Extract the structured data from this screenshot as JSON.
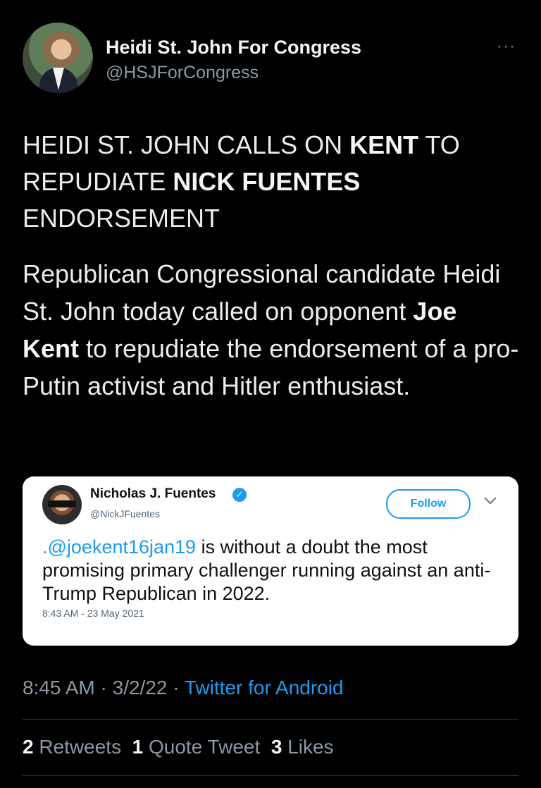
{
  "author": {
    "display_name": "Heidi St. John For Congress",
    "handle": "@HSJForCongress",
    "avatar_icon": "profile-photo",
    "more_icon": "···"
  },
  "tweet": {
    "headline": {
      "part1": "HEIDI ST. JOHN CALLS ON ",
      "bold1": "KENT",
      "part2": " TO REPUDIATE ",
      "bold2": "NICK FUENTES",
      "part3": " ENDORSEMENT"
    },
    "body": {
      "part1": "Republican Congressional candidate Heidi St. John today called on opponent ",
      "bold": "Joe Kent",
      "part2": " to repudiate the endorsement of a pro-Putin activist and Hitler enthusiast."
    },
    "time": "8:45 AM",
    "separator1": "·",
    "date": "3/2/22",
    "separator2": "·",
    "source": "Twitter for Android"
  },
  "quoted_tweet": {
    "name": "Nicholas J. Fuentes",
    "verified_mark": "✓",
    "handle": "@NickJFuentes",
    "follow_label": "Follow",
    "mention": ".@joekent16jan19",
    "text": " is without a doubt the most promising primary challenger running against an anti-Trump Republican in 2022.",
    "timestamp": "8:43 AM - 23 May 2021"
  },
  "stats": {
    "retweets_count": "2",
    "retweets_label": "Retweets",
    "quotes_count": "1",
    "quotes_label": "Quote Tweet",
    "likes_count": "3",
    "likes_label": "Likes"
  },
  "colors": {
    "background": "#000000",
    "link": "#1d9bf0",
    "secondary_text": "#8b98a5",
    "card_background": "#ffffff"
  }
}
